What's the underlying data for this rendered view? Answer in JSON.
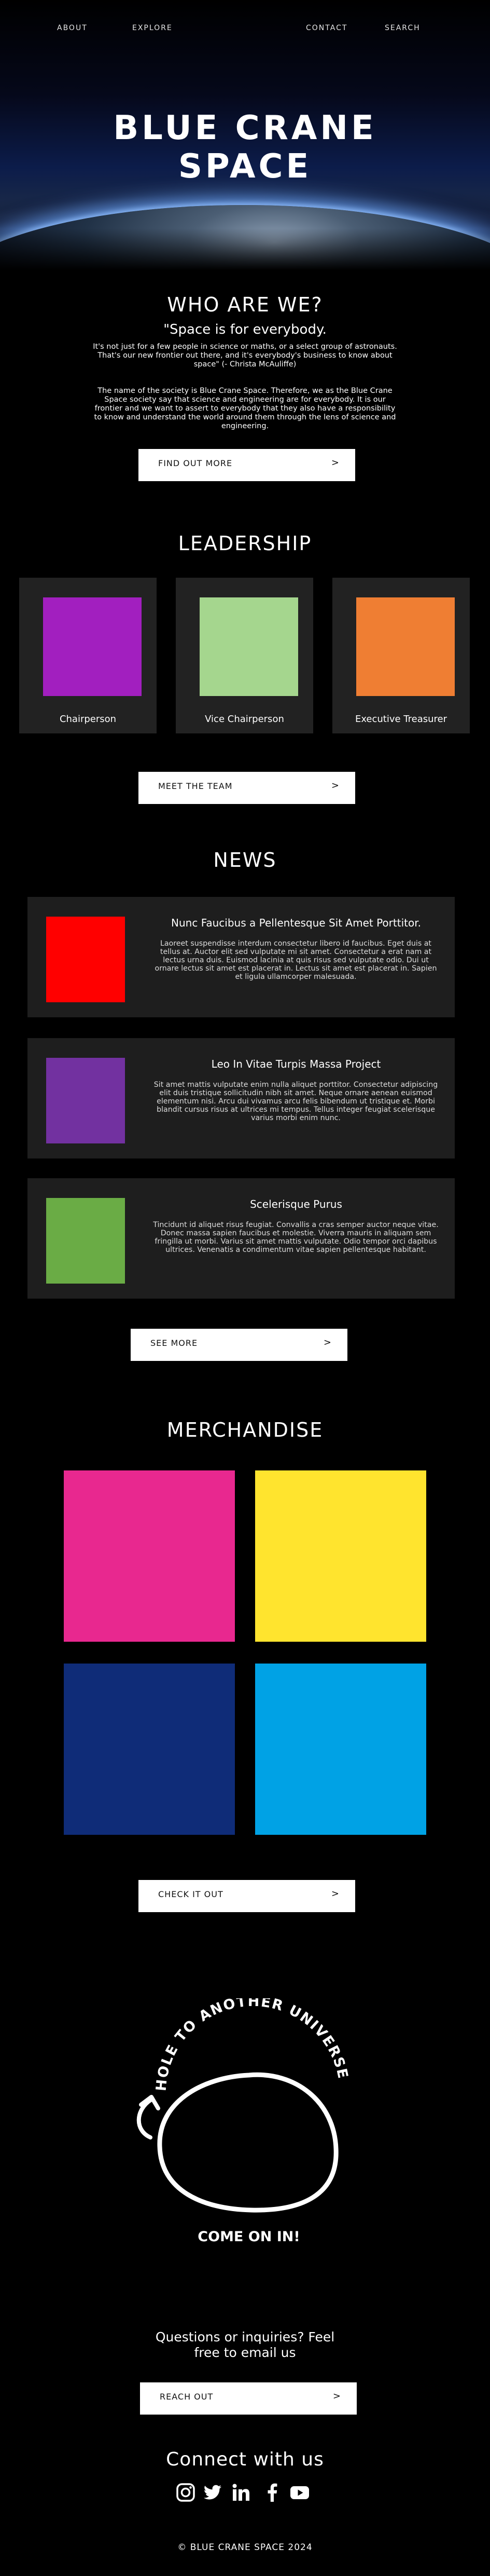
{
  "nav": {
    "about": "ABOUT",
    "explore": "EXPLORE",
    "contact": "CONTACT",
    "search": "SEARCH"
  },
  "hero": {
    "title_line1": "BLUE CRANE",
    "title_line2": "SPACE"
  },
  "who": {
    "heading": "WHO ARE WE?",
    "quote": "\"Space is for everybody.",
    "quote_body": "It's not just for a few people in science or maths, or a select group of astronauts. That's our new frontier out there, and it's everybody's business to know about space\" (- Christa McAuliffe)",
    "paragraph": "The name of the society is Blue Crane Space. Therefore, we as the Blue Crane Space society say that science and engineering are for everybody. It is our frontier and we want to assert to everybody that they also have a responsibility to know and understand the world around them through the lens of science and engineering.",
    "button": "FIND OUT MORE",
    "arrow": ">"
  },
  "leadership": {
    "heading": "LEADERSHIP",
    "members": [
      {
        "role": "Chairperson",
        "color": "#a21fbf"
      },
      {
        "role": "Vice Chairperson",
        "color": "#a5d68e"
      },
      {
        "role": "Executive Treasurer",
        "color": "#ef7e33"
      }
    ],
    "button": "MEET THE TEAM",
    "arrow": ">"
  },
  "news": {
    "heading": "NEWS",
    "items": [
      {
        "title": "Nunc Faucibus a Pellentesque Sit Amet Porttitor.",
        "text": "Laoreet suspendisse interdum consectetur libero id faucibus. Eget duis at tellus at. Auctor elit sed vulputate mi sit amet. Consectetur a erat nam at lectus urna duis. Euismod lacinia at quis risus sed vulputate odio. Dui ut ornare lectus sit amet est placerat in. Lectus sit amet est placerat in. Sapien et ligula ullamcorper malesuada.",
        "color": "#ff0000"
      },
      {
        "title": "Leo In Vitae Turpis Massa Project",
        "text": "Sit amet mattis vulputate enim nulla aliquet porttitor. Consectetur adipiscing elit duis tristique sollicitudin nibh sit amet. Neque ornare aenean euismod elementum nisi. Arcu dui vivamus arcu felis bibendum ut tristique et. Morbi blandit cursus risus at ultrices mi tempus. Tellus integer feugiat scelerisque varius morbi enim nunc.",
        "color": "#7231a0"
      },
      {
        "title": "Scelerisque Purus",
        "text": "Tincidunt id aliquet risus feugiat. Convallis a cras semper auctor neque vitae. Donec massa sapien faucibus et molestie. Viverra mauris in aliquam sem fringilla ut morbi. Varius sit amet mattis vulputate. Odio tempor orci dapibus ultrices. Venenatis a condimentum vitae sapien pellentesque habitant.",
        "color": "#6aac45"
      }
    ],
    "button": "SEE MORE",
    "arrow": ">"
  },
  "merch": {
    "heading": "MERCHANDISE",
    "items": [
      {
        "color": "#e8288f"
      },
      {
        "color": "#ffe42e"
      },
      {
        "color": "#0f2c78"
      },
      {
        "color": "#00a2e5"
      }
    ],
    "button": "CHECK IT OUT",
    "arrow": ">"
  },
  "hole": {
    "top_text": "HOLE TO ANOTHER UNIVERSE",
    "bottom_text": "COME ON IN!"
  },
  "contact": {
    "question_line1": "Questions or inquiries? Feel",
    "question_line2": "free to email us",
    "button": "REACH OUT",
    "arrow": ">"
  },
  "footer": {
    "connect": "Connect with us",
    "icons": [
      "instagram-icon",
      "twitter-icon",
      "linkedin-icon",
      "facebook-icon",
      "youtube-icon"
    ],
    "copyright": "© BLUE CRANE SPACE 2024"
  }
}
